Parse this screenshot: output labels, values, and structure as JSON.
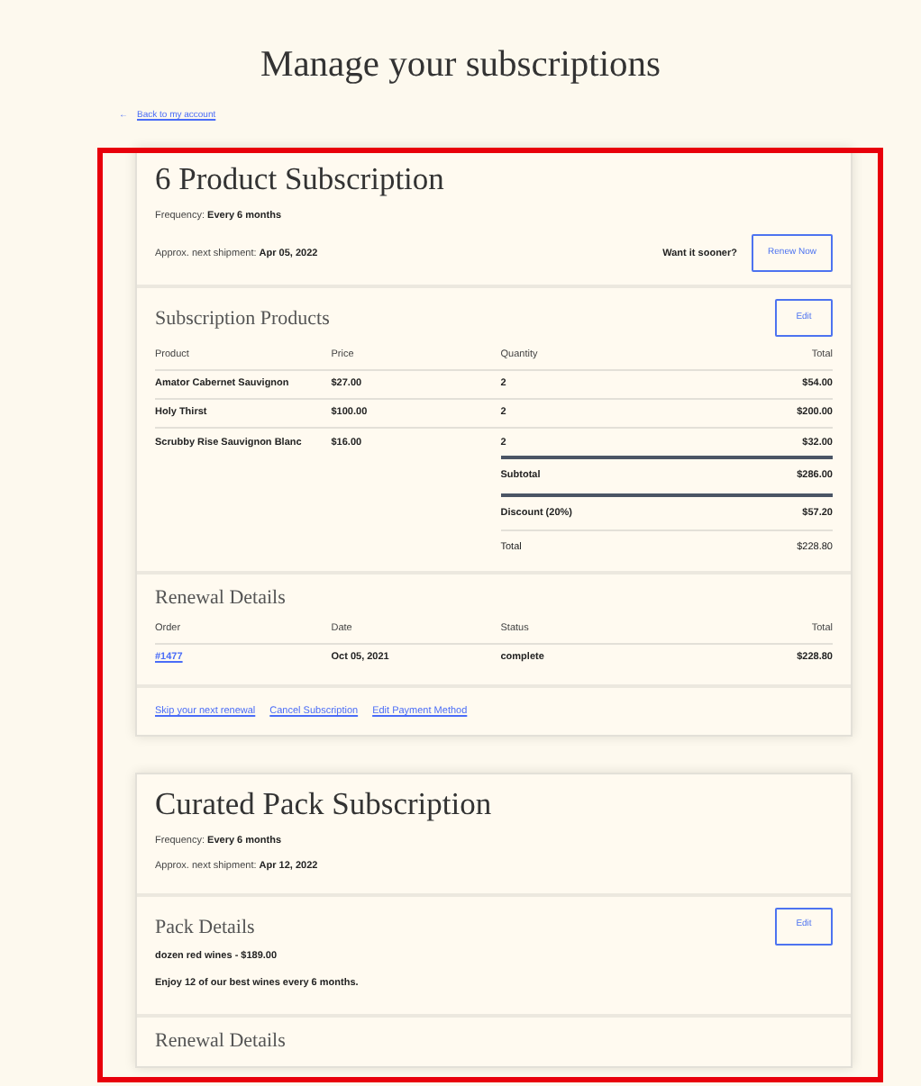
{
  "page_title": "Manage your subscriptions",
  "back_link": {
    "arrow": "←",
    "label": "Back to my account"
  },
  "subscriptions": [
    {
      "title": "6 Product Subscription",
      "frequency_label": "Frequency:",
      "frequency": "Every 6 months",
      "shipment_label": "Approx. next shipment:",
      "shipment": "Apr 05, 2022",
      "sooner_prompt": "Want it sooner?",
      "renew_button": "Renew Now",
      "sections": [
        {
          "kind": "products",
          "heading": "Subscription Products",
          "edit_button": "Edit",
          "columns": [
            "Product",
            "Price",
            "Quantity",
            "Total"
          ],
          "rows": [
            [
              "Amator Cabernet Sauvignon",
              "$27.00",
              "2",
              "$54.00"
            ],
            [
              "Holy Thirst",
              "$100.00",
              "2",
              "$200.00"
            ],
            [
              "Scrubby Rise Sauvignon Blanc",
              "$16.00",
              "2",
              "$32.00"
            ]
          ],
          "summary": [
            {
              "label": "Subtotal",
              "value": "$286.00",
              "strong_rule": true
            },
            {
              "label": "Discount (20%)",
              "value": "$57.20",
              "strong_rule": true
            },
            {
              "label": "Total",
              "value": "$228.80",
              "strong_rule": false
            }
          ]
        },
        {
          "kind": "renewals",
          "heading": "Renewal Details",
          "columns": [
            "Order",
            "Date",
            "Status",
            "Total"
          ],
          "rows": [
            [
              "#1477",
              "Oct 05, 2021",
              "complete",
              "$228.80"
            ]
          ]
        }
      ],
      "links": [
        "Skip your next renewal",
        "Cancel Subscription",
        "Edit Payment Method"
      ]
    },
    {
      "title": "Curated Pack Subscription",
      "frequency_label": "Frequency:",
      "frequency": "Every 6 months",
      "shipment_label": "Approx. next shipment:",
      "shipment": "Apr 12, 2022",
      "sections": [
        {
          "kind": "pack",
          "heading": "Pack Details",
          "edit_button": "Edit",
          "lines": [
            "dozen red wines - $189.00",
            "Enjoy 12 of our best wines every 6 months."
          ]
        },
        {
          "kind": "renewals",
          "heading": "Renewal Details"
        }
      ]
    }
  ]
}
